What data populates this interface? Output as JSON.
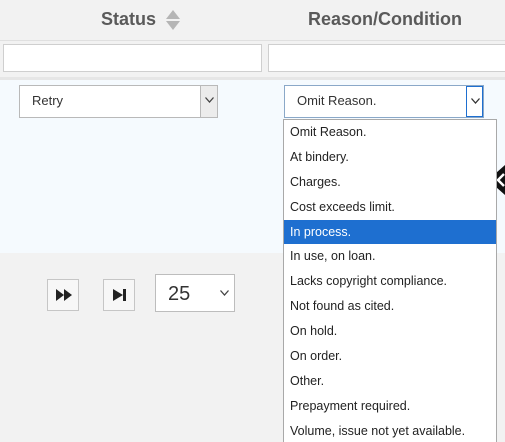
{
  "header": {
    "status_label": "Status",
    "reason_label": "Reason/Condition",
    "sort_icon": "sort-up-down-icon"
  },
  "filters": {
    "status_value": "",
    "reason_value": ""
  },
  "edit_row": {
    "status_select": {
      "value": "Retry",
      "icon": "chevron-down-icon"
    },
    "reason_select": {
      "value": "Omit Reason.",
      "icon": "chevron-down-icon",
      "open": true
    }
  },
  "reason_options": [
    {
      "label": "Omit Reason.",
      "selected": false
    },
    {
      "label": "At bindery.",
      "selected": false
    },
    {
      "label": "Charges.",
      "selected": false
    },
    {
      "label": "Cost exceeds limit.",
      "selected": false
    },
    {
      "label": "In process.",
      "selected": true
    },
    {
      "label": "In use, on loan.",
      "selected": false
    },
    {
      "label": "Lacks copyright compliance.",
      "selected": false
    },
    {
      "label": "Not found as cited.",
      "selected": false
    },
    {
      "label": "On hold.",
      "selected": false
    },
    {
      "label": "On order.",
      "selected": false
    },
    {
      "label": "Other.",
      "selected": false
    },
    {
      "label": "Prepayment required.",
      "selected": false
    },
    {
      "label": "Volume, issue not yet available.",
      "selected": false
    }
  ],
  "pager": {
    "next_icon": "fast-forward-icon",
    "last_icon": "skip-to-end-icon",
    "page_size": "25",
    "page_size_icon": "chevron-down-icon"
  },
  "colors": {
    "highlight": "#1e6fd0",
    "header_bg": "#f2f2f2",
    "row_bg": "#f5fafe"
  }
}
